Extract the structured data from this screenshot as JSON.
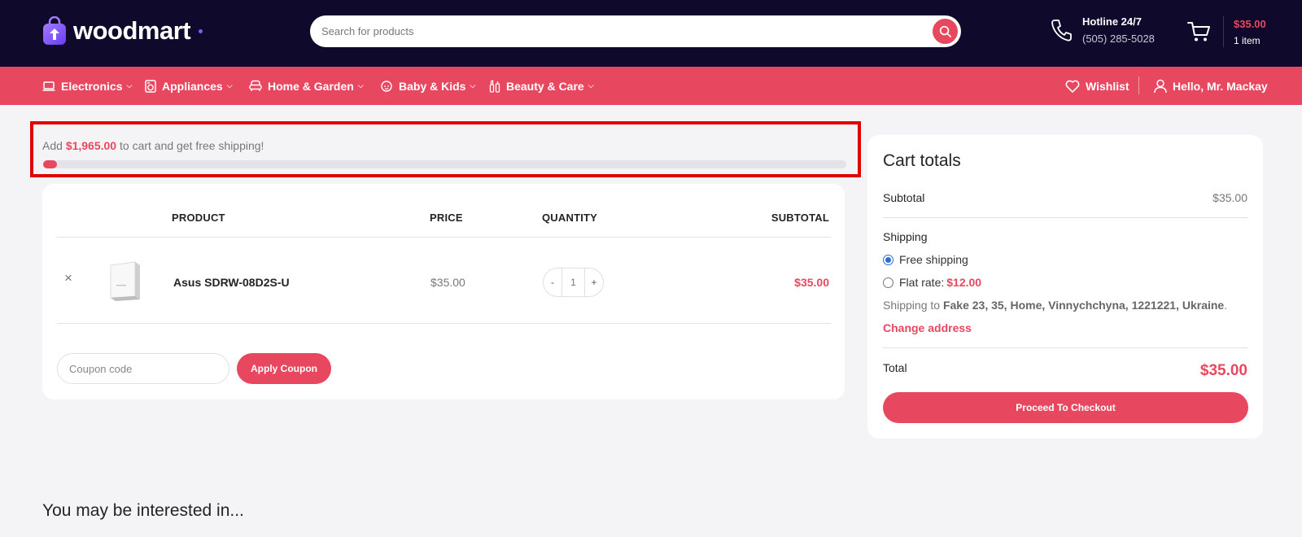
{
  "header": {
    "logo_text": "woodmart",
    "search_placeholder": "Search for products",
    "hotline_title": "Hotline 24/7",
    "hotline_phone": "(505) 285-5028",
    "cart_amount": "$35.00",
    "cart_count": "1 item"
  },
  "nav": {
    "items": [
      {
        "label": "Electronics",
        "icon": "laptop-icon"
      },
      {
        "label": "Appliances",
        "icon": "washing-machine-icon"
      },
      {
        "label": "Home & Garden",
        "icon": "armchair-icon"
      },
      {
        "label": "Baby & Kids",
        "icon": "baby-icon"
      },
      {
        "label": "Beauty & Care",
        "icon": "cosmetics-icon"
      }
    ],
    "wishlist": "Wishlist",
    "account": "Hello, Mr. Mackay"
  },
  "notice": {
    "prefix": "Add",
    "amount": "$1,965.00",
    "suffix": "to cart and get free shipping!",
    "progress_fraction": 0.017
  },
  "cart_table": {
    "headers": {
      "product": "PRODUCT",
      "price": "PRICE",
      "quantity": "QUANTITY",
      "subtotal": "SUBTOTAL"
    },
    "items": [
      {
        "name": "Asus SDRW-08D2S-U",
        "price": "$35.00",
        "qty": "1",
        "subtotal": "$35.00"
      }
    ],
    "remove_symbol": "×",
    "qty_minus": "-",
    "qty_plus": "+",
    "coupon_placeholder": "Coupon code",
    "apply_label": "Apply Coupon"
  },
  "totals": {
    "title": "Cart totals",
    "subtotal_label": "Subtotal",
    "subtotal_value": "$35.00",
    "shipping_label": "Shipping",
    "free_shipping": "Free shipping",
    "flat_rate_label": "Flat rate:",
    "flat_rate_value": "$12.00",
    "shipping_to_prefix": "Shipping to",
    "shipping_to_address": "Fake 23, 35, Home, Vinnychchyna, 1221221, Ukraine",
    "shipping_to_suffix": ".",
    "change_address": "Change address",
    "total_label": "Total",
    "total_value": "$35.00",
    "checkout_label": "Proceed To Checkout"
  },
  "interested_heading": "You may be interested in...",
  "colors": {
    "brand": "#e8485f",
    "header_bg": "#0f0a2c",
    "page_bg": "#f4f4f6"
  }
}
